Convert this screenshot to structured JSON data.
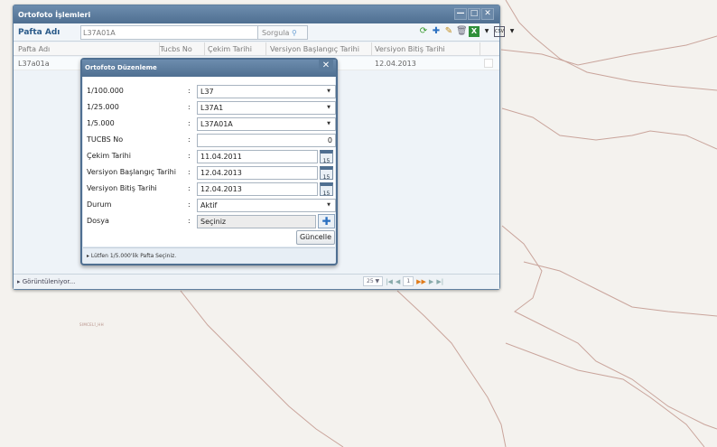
{
  "map": {
    "label": "SIMCELİ_HH"
  },
  "window": {
    "title": "Ortofoto İşlemleri",
    "minimize_glyph": "—",
    "maximize_glyph": "□",
    "close_glyph": "✕",
    "toolbar": {
      "field_label": "Pafta Adı",
      "field_value": "L37A01A",
      "query_button": "Sorgula",
      "icons": [
        "refresh-icon",
        "add-icon",
        "edit-icon",
        "delete-icon",
        "excel-icon",
        "dropdown-icon",
        "csv-icon",
        "dropdown-icon"
      ]
    },
    "grid": {
      "columns": [
        "Pafta Adı",
        "Tucbs No",
        "Çekim Tarihi",
        "Versiyon Başlangıç Tarihi",
        "Versiyon Bitiş Tarihi"
      ],
      "rows": [
        {
          "pafta": "L37a01a",
          "tucbs": "",
          "cekim": "",
          "baslangic": "",
          "bitis": "12.04.2013"
        }
      ]
    },
    "footer": {
      "status": "▸ Görüntüleniyor...",
      "page_size": "25",
      "page": "1"
    }
  },
  "dialog": {
    "title": "Ortofoto Düzenleme",
    "close_glyph": "✕",
    "fields": {
      "s100000": {
        "label": "1/100.000",
        "value": "L37"
      },
      "s25000": {
        "label": "1/25.000",
        "value": "L37A1"
      },
      "s5000": {
        "label": "1/5.000",
        "value": "L37A01A"
      },
      "tucbs": {
        "label": "TUCBS No",
        "value": "0"
      },
      "cekim": {
        "label": "Çekim Tarihi",
        "value": "11.04.2011"
      },
      "baslangic": {
        "label": "Versiyon Başlangıç Tarihi",
        "value": "12.04.2013"
      },
      "bitis": {
        "label": "Versiyon Bitiş Tarihi",
        "value": "12.04.2013"
      },
      "durum": {
        "label": "Durum",
        "value": "Aktif"
      },
      "dosya": {
        "label": "Dosya",
        "value": "Seçiniz"
      }
    },
    "calendar_day": "15",
    "update_button": "Güncelle",
    "hint": "▸ Lütfen 1/5.000'lik Pafta Seçiniz."
  }
}
